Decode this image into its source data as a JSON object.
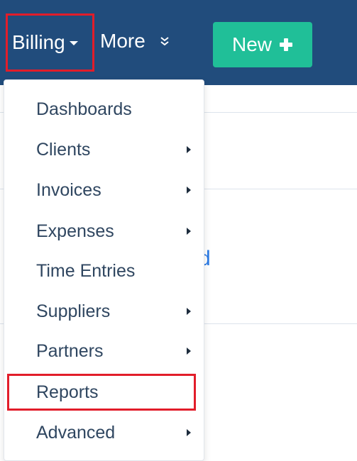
{
  "topnav": {
    "billing_label": "Billing",
    "more_label": "More",
    "new_button_label": "New",
    "background_color": "#214c7c",
    "new_button_color": "#20bf98"
  },
  "background": {
    "link_fragment": "d"
  },
  "dropdown": {
    "items": [
      {
        "label": "Dashboards",
        "submenu": false
      },
      {
        "label": "Clients",
        "submenu": true
      },
      {
        "label": "Invoices",
        "submenu": true
      },
      {
        "label": "Expenses",
        "submenu": true
      },
      {
        "label": "Time Entries",
        "submenu": false
      },
      {
        "label": "Suppliers",
        "submenu": true
      },
      {
        "label": "Partners",
        "submenu": true
      },
      {
        "label": "Reports",
        "submenu": false
      },
      {
        "label": "Advanced",
        "submenu": true
      }
    ]
  },
  "annotation_color": "#e21d2a"
}
